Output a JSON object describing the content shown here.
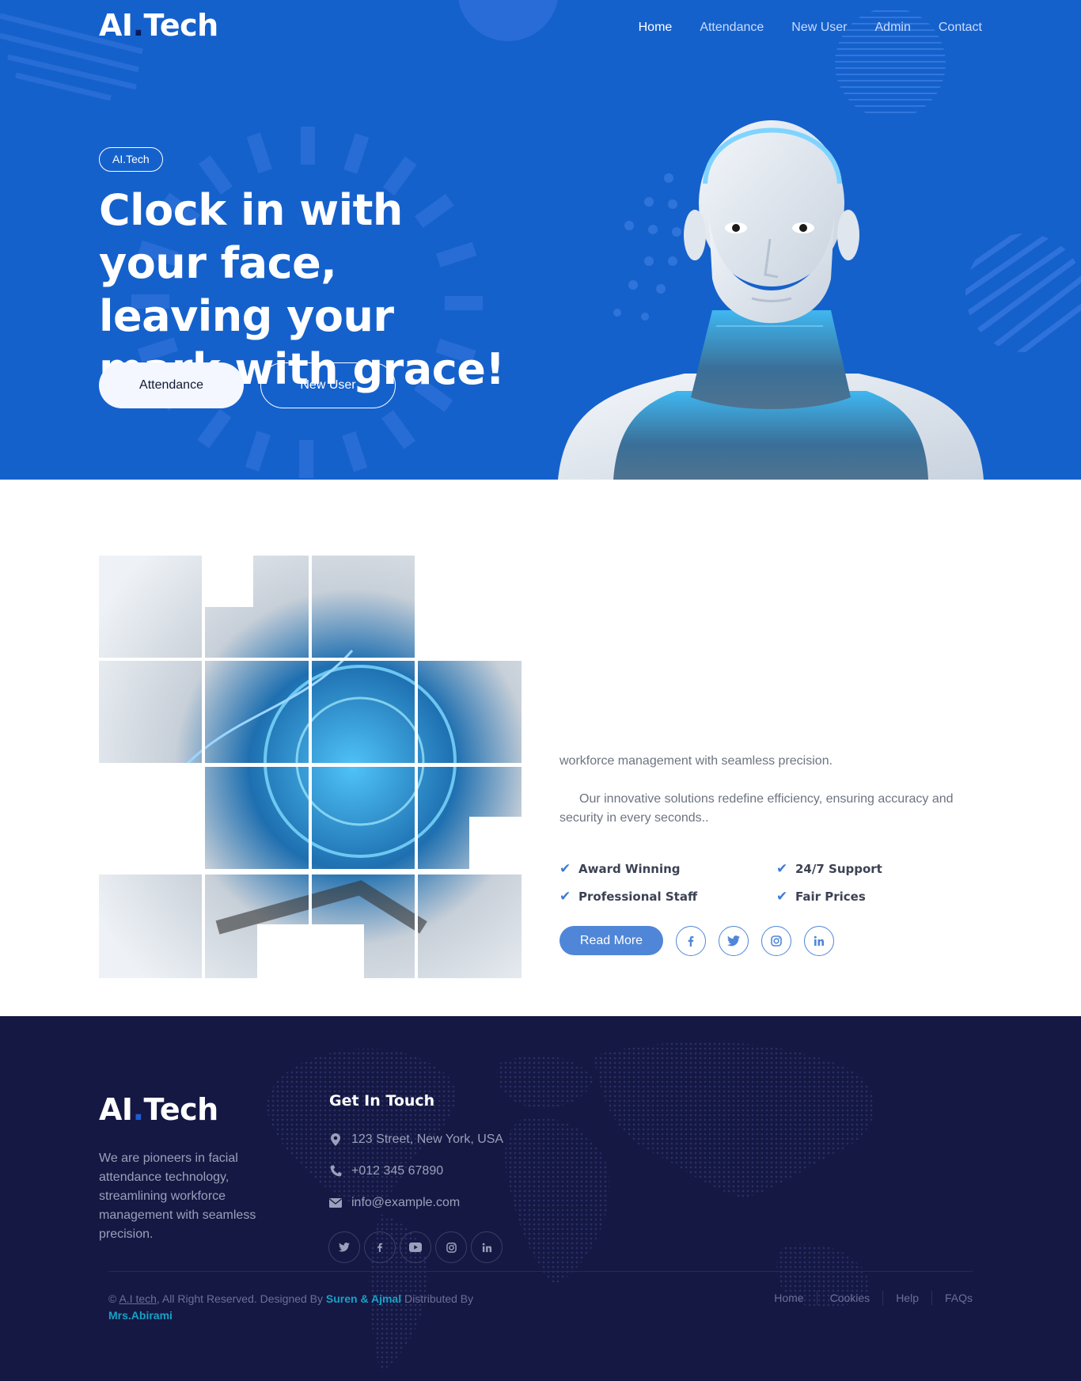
{
  "brand": {
    "name_part1": "AI",
    "name_dot": ".",
    "name_part2": "Tech"
  },
  "nav": {
    "items": [
      {
        "label": "Home",
        "active": true
      },
      {
        "label": "Attendance",
        "active": false
      },
      {
        "label": "New User",
        "active": false
      },
      {
        "label": "Admin",
        "active": false
      },
      {
        "label": "Contact",
        "active": false
      }
    ]
  },
  "hero": {
    "badge": "AI.Tech",
    "title": "Clock in with your face, leaving your mark with grace!",
    "primary_button": "Attendance",
    "secondary_button": "New User",
    "image": "humanoid-robot-bust"
  },
  "about": {
    "image": "robot-mosaic-grid",
    "paragraph1_visible": "workforce management with seamless precision.",
    "paragraph2": "Our innovative solutions redefine efficiency, ensuring accuracy and security in every seconds..",
    "features": [
      "Award Winning",
      "24/7 Support",
      "Professional Staff",
      "Fair Prices"
    ],
    "read_more": "Read More",
    "social_icons": [
      "facebook-icon",
      "twitter-icon",
      "instagram-icon",
      "linkedin-icon"
    ]
  },
  "footer": {
    "brand_part1": "AI",
    "brand_dot": ".",
    "brand_part2": "Tech",
    "about": "We are pioneers in facial attendance technology, streamlining workforce management with seamless precision.",
    "contact_title": "Get In Touch",
    "address": "123 Street, New York, USA",
    "phone": "+012 345 67890",
    "email": "info@example.com",
    "social_icons": [
      "twitter-icon",
      "facebook-icon",
      "youtube-icon",
      "instagram-icon",
      "linkedin-icon"
    ],
    "copyright_prefix": "©",
    "copyright_link": "A.I tech",
    "copyright_mid": ", All Right Reserved. Designed By",
    "designer": "Suren & Ajmal",
    "distributed_by": "Distributed By",
    "distributor": "Mrs.Abirami",
    "links": [
      "Home",
      "Cookies",
      "Help",
      "FAQs"
    ]
  },
  "colors": {
    "hero_bg": "#1561cc",
    "accent": "#4f86d8",
    "footer_bg": "#151843",
    "highlight": "#17a2c7"
  }
}
